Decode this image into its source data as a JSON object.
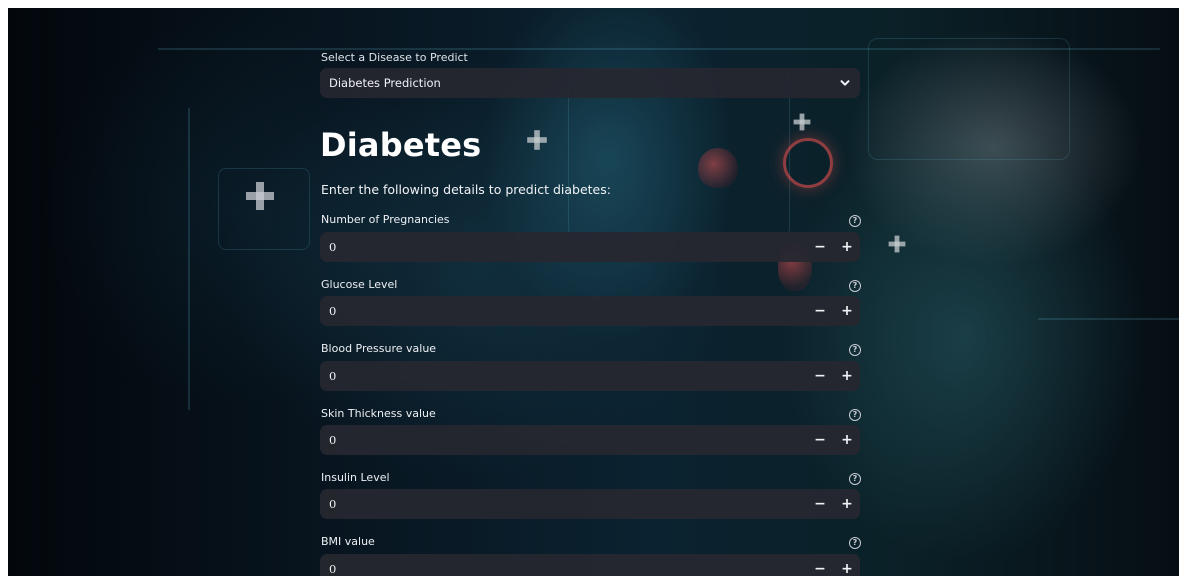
{
  "disease_select": {
    "label": "Select a Disease to Predict",
    "selected": "Diabetes Prediction",
    "icon": "chevron-down-icon"
  },
  "page": {
    "title": "Diabetes",
    "subtitle": "Enter the following details to predict diabetes:"
  },
  "stepper": {
    "minus": "−",
    "plus": "+"
  },
  "help_glyph": "?",
  "fields": [
    {
      "label": "Number of Pregnancies",
      "value": "0"
    },
    {
      "label": "Glucose Level",
      "value": "0"
    },
    {
      "label": "Blood Pressure value",
      "value": "0"
    },
    {
      "label": "Skin Thickness value",
      "value": "0"
    },
    {
      "label": "Insulin Level",
      "value": "0"
    },
    {
      "label": "BMI value",
      "value": "0"
    }
  ],
  "colors": {
    "background": "#07101a",
    "input_bg": "#262730",
    "text": "#f0f2f6"
  }
}
